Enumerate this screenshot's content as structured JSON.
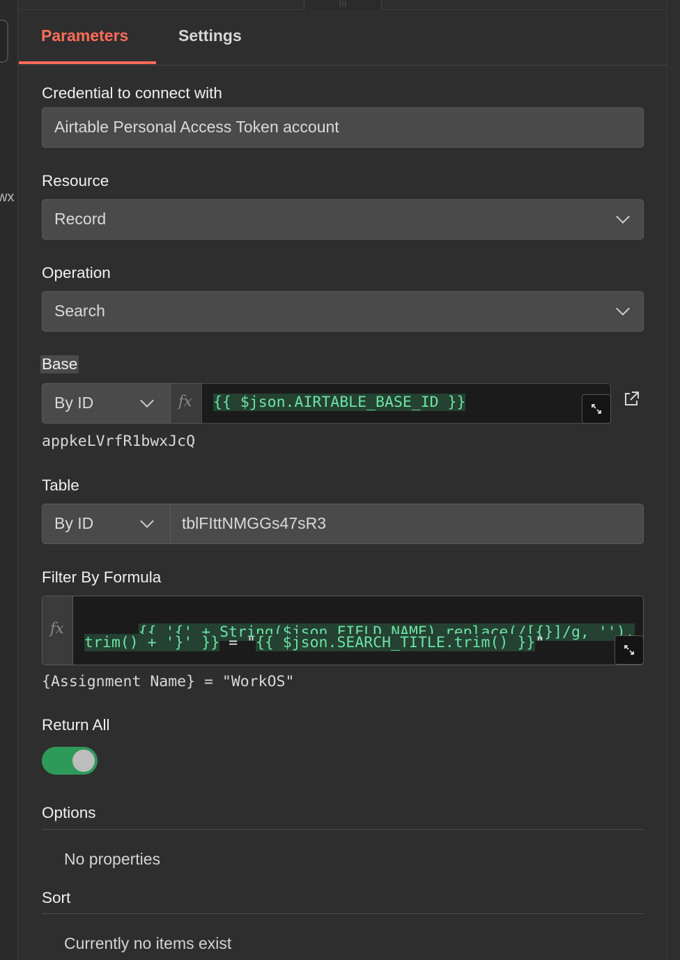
{
  "left_fragment": "wx",
  "tabs": [
    {
      "label": "Parameters",
      "active": true
    },
    {
      "label": "Settings",
      "active": false
    }
  ],
  "credential": {
    "label": "Credential to connect with",
    "value": "Airtable Personal Access Token account"
  },
  "resource": {
    "label": "Resource",
    "value": "Record"
  },
  "operation": {
    "label": "Operation",
    "value": "Search"
  },
  "base": {
    "label": "Base",
    "mode": "By ID",
    "expression": "{{ $json.AIRTABLE_BASE_ID }}",
    "resolved": "appkeLVrfR1bwxJcQ"
  },
  "table": {
    "label": "Table",
    "mode": "By ID",
    "value": "tblFIttNMGGs47sR3"
  },
  "filter": {
    "label": "Filter By Formula",
    "line1": "{{ '{' + String($json.FIELD_NAME).replace(/[{}]/g, '').",
    "line2_expr": "trim() + '}' }}",
    "line2_mid": " = \"",
    "line2_expr2": "{{ $json.SEARCH_TITLE.trim() }}",
    "line2_end": "\"",
    "resolved": "{Assignment Name} = \"WorkOS\""
  },
  "return_all": {
    "label": "Return All",
    "enabled": true
  },
  "options": {
    "label": "Options",
    "empty_text": "No properties"
  },
  "sort": {
    "label": "Sort",
    "empty_text": "Currently no items exist"
  },
  "icons": {
    "fx": "fx",
    "grip": "|||"
  },
  "colors": {
    "accent": "#ff6d5a",
    "toggle_on": "#2e9a5a",
    "expr_text": "#6ee3a4",
    "expr_bg": "#244132"
  }
}
